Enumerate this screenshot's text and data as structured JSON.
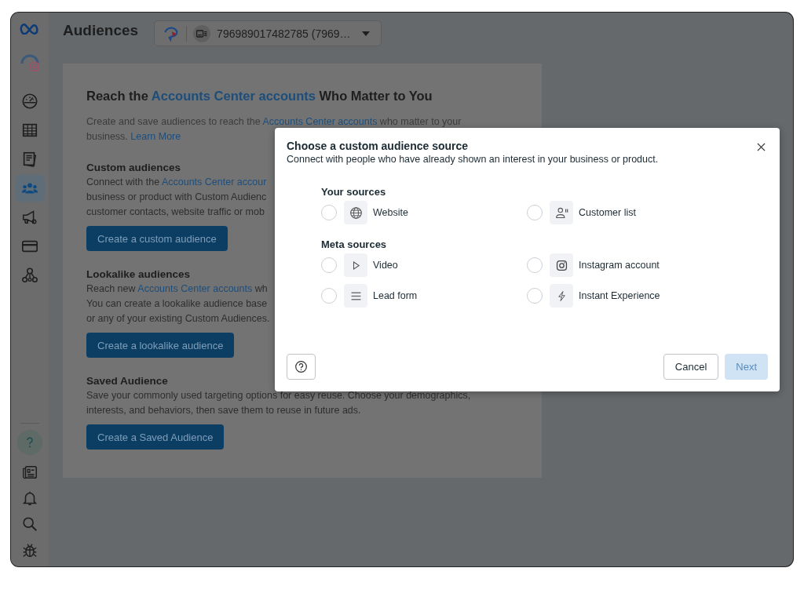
{
  "sidebar": {
    "nav_items": [
      {
        "selected": false
      },
      {
        "selected": false
      },
      {
        "selected": false
      },
      {
        "selected": true
      },
      {
        "selected": false
      },
      {
        "selected": false
      },
      {
        "selected": false
      }
    ]
  },
  "header": {
    "title": "Audiences",
    "account_selector": {
      "value": "796989017482785 (7969…"
    }
  },
  "card": {
    "heading": [
      {
        "kind": "text",
        "text": "Reach the "
      },
      {
        "kind": "link",
        "text": "Accounts Center accounts"
      },
      {
        "kind": "text",
        "text": " Who Matter to You"
      }
    ],
    "intro": [
      [
        {
          "kind": "text",
          "text": "Create and save audiences to reach the "
        },
        {
          "kind": "link",
          "text": "Accounts Center accounts"
        },
        {
          "kind": "text",
          "text": " who matter to your"
        }
      ],
      [
        {
          "kind": "text",
          "text": "business. "
        },
        {
          "kind": "link",
          "text": "Learn More"
        }
      ]
    ],
    "sections": [
      {
        "title": "Custom audiences",
        "lines": [
          [
            {
              "kind": "text",
              "text": "Connect with the "
            },
            {
              "kind": "link",
              "text": "Accounts Center accour"
            }
          ],
          [
            {
              "kind": "text",
              "text": "business or product with Custom Audienc"
            }
          ],
          [
            {
              "kind": "text",
              "text": "customer contacts, website traffic or mob"
            }
          ]
        ],
        "button": "Create a custom audience"
      },
      {
        "title": "Lookalike audiences",
        "lines": [
          [
            {
              "kind": "text",
              "text": "Reach new "
            },
            {
              "kind": "link",
              "text": "Accounts Center accounts"
            },
            {
              "kind": "text",
              "text": " wh"
            }
          ],
          [
            {
              "kind": "text",
              "text": "You can create a lookalike audience base"
            }
          ],
          [
            {
              "kind": "text",
              "text": "or any of your existing Custom Audiences."
            }
          ]
        ],
        "button": "Create a lookalike audience"
      },
      {
        "title": "Saved Audience",
        "lines": [
          [
            {
              "kind": "text",
              "text": "Save your commonly used targeting options for easy reuse. Choose your demographics,"
            }
          ],
          [
            {
              "kind": "text",
              "text": "interests, and behaviors, then save them to reuse in future ads."
            }
          ]
        ],
        "button": "Create a Saved Audience"
      }
    ]
  },
  "dialog": {
    "title": "Choose a custom audience source",
    "subtitle": "Connect with people who have already shown an interest in your business or product.",
    "groups": [
      {
        "title": "Your sources",
        "options": [
          {
            "kind": "website",
            "label": "Website",
            "selected": false
          },
          {
            "kind": "customer_list",
            "label": "Customer list",
            "selected": false
          }
        ]
      },
      {
        "title": "Meta sources",
        "options": [
          {
            "kind": "video",
            "label": "Video",
            "selected": false
          },
          {
            "kind": "instagram",
            "label": "Instagram account",
            "selected": false
          },
          {
            "kind": "lead_form",
            "label": "Lead form",
            "selected": false
          },
          {
            "kind": "instant_experience",
            "label": "Instant Experience",
            "selected": false
          }
        ]
      }
    ],
    "buttons": {
      "cancel": "Cancel",
      "next": {
        "label": "Next",
        "disabled": true
      }
    }
  }
}
